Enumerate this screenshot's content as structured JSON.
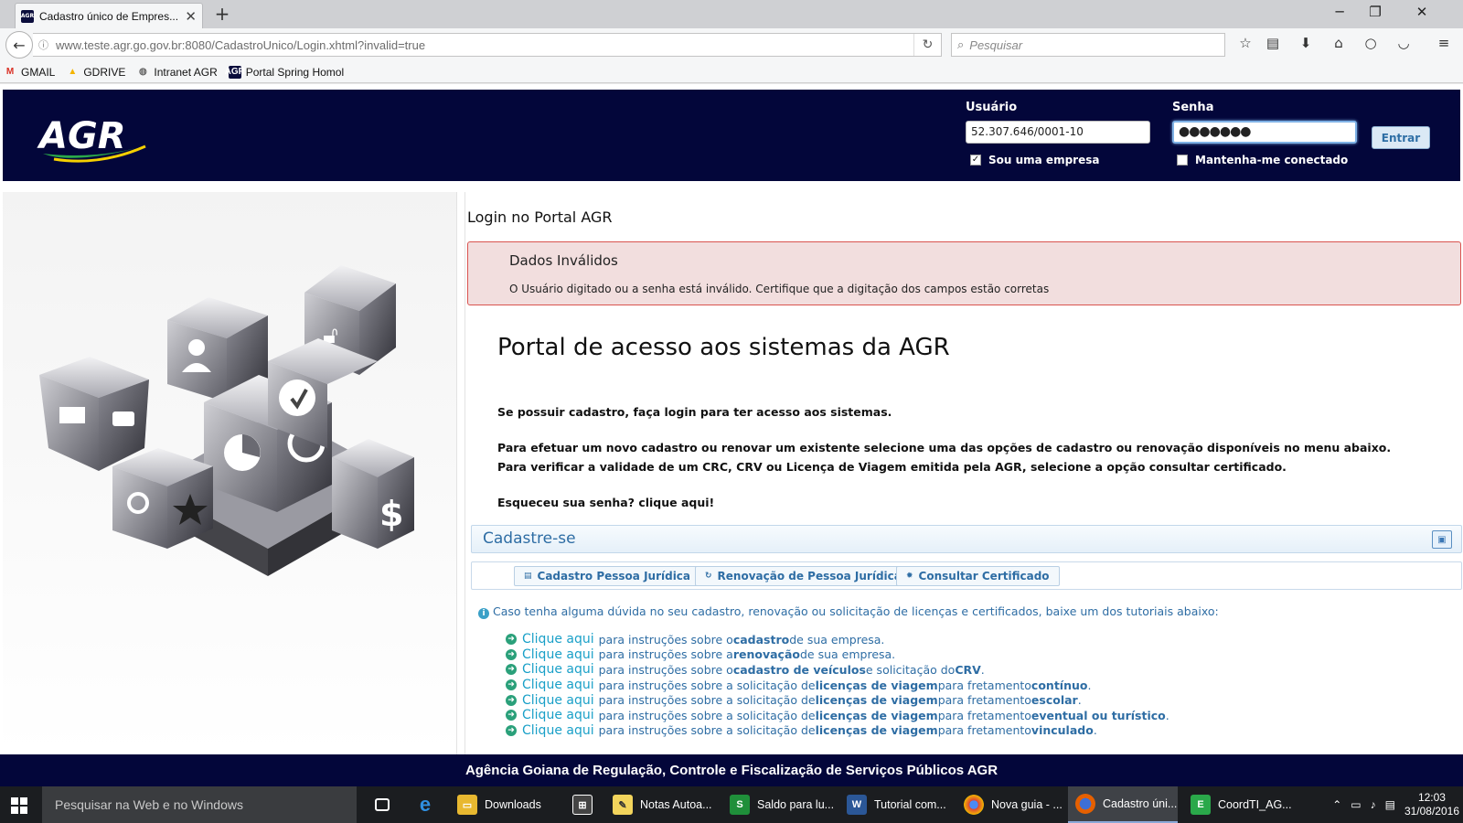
{
  "browser": {
    "tab_title": "Cadastro único de Empres...",
    "url": "www.teste.agr.go.gov.br:8080/CadastroUnico/Login.xhtml?invalid=true",
    "search_placeholder": "Pesquisar",
    "bookmarks": [
      "GMAIL",
      "GDRIVE",
      "Intranet AGR",
      "Portal Spring Homol"
    ]
  },
  "header": {
    "logo_text": "AGR",
    "usuario_label": "Usuário",
    "usuario_value": "52.307.646/0001-10",
    "senha_label": "Senha",
    "senha_value": "●●●●●●●",
    "entrar_label": "Entrar",
    "sou_empresa_label": "Sou uma empresa",
    "sou_empresa_checked": true,
    "mantenha_label": "Mantenha-me conectado",
    "mantenha_checked": false
  },
  "main": {
    "section_title": "Login no Portal AGR",
    "error_title": "Dados Inválidos",
    "error_message": "O Usuário digitado ou a senha está inválido. Certifique que a digitação dos campos estão corretas",
    "portal_title": "Portal de acesso aos sistemas da AGR",
    "intro_1": "Se possuir cadastro, faça login para ter acesso aos sistemas.",
    "intro_2": "Para efetuar um novo cadastro ou renovar um existente selecione uma das opções de cadastro ou renovação disponíveis no menu abaixo.",
    "intro_3": "Para verificar a validade de um CRC, CRV ou Licença de Viagem emitida pela AGR, selecione a opção consultar certificado.",
    "intro_4": "Esqueceu sua senha? clique aqui!",
    "cadastre_title": "Cadastre-se",
    "buttons": [
      "Cadastro Pessoa Jurídica",
      "Renovação de Pessoa Jurídica",
      "Consultar Certificado"
    ],
    "help_text": "Caso tenha alguma dúvida no seu cadastro, renovação ou solicitação de licenças e certificados, baixe um dos tutoriais abaixo:",
    "tutorial_link": "Clique aqui",
    "tutorials": [
      [
        "para instruções sobre o ",
        "cadastro",
        " de sua empresa.",
        "",
        ""
      ],
      [
        "para instruções sobre a ",
        "renovação",
        " de sua empresa.",
        "",
        ""
      ],
      [
        "para instruções sobre o ",
        "cadastro de veículos",
        " e solicitação do ",
        "CRV",
        "."
      ],
      [
        "para instruções sobre a solicitação de ",
        "licenças de viagem",
        " para fretamento ",
        "contínuo",
        "."
      ],
      [
        "para instruções sobre a solicitação de ",
        "licenças de viagem",
        " para fretamento ",
        "escolar",
        "."
      ],
      [
        "para instruções sobre a solicitação de ",
        "licenças de viagem",
        " para fretamento ",
        "eventual ou turístico",
        "."
      ],
      [
        "para instruções sobre a solicitação de ",
        "licenças de viagem",
        " para fretamento ",
        "vinculado",
        "."
      ]
    ]
  },
  "footer": {
    "text": "Agência Goiana de Regulação, Controle e Fiscalização de Serviços Públicos   AGR"
  },
  "taskbar": {
    "search_placeholder": "Pesquisar na Web e no Windows",
    "items": [
      "Downloads",
      "Notas Autoa...",
      "Saldo para lu...",
      "Tutorial com...",
      "Nova guia - ...",
      "Cadastro úni...",
      "CoordTI_AG..."
    ],
    "time": "12:03",
    "date": "31/08/2016"
  },
  "colors": {
    "header_bg": "#03063a",
    "link_blue": "#2e6da4",
    "error_bg": "#f2dede",
    "error_border": "#d9534f"
  }
}
